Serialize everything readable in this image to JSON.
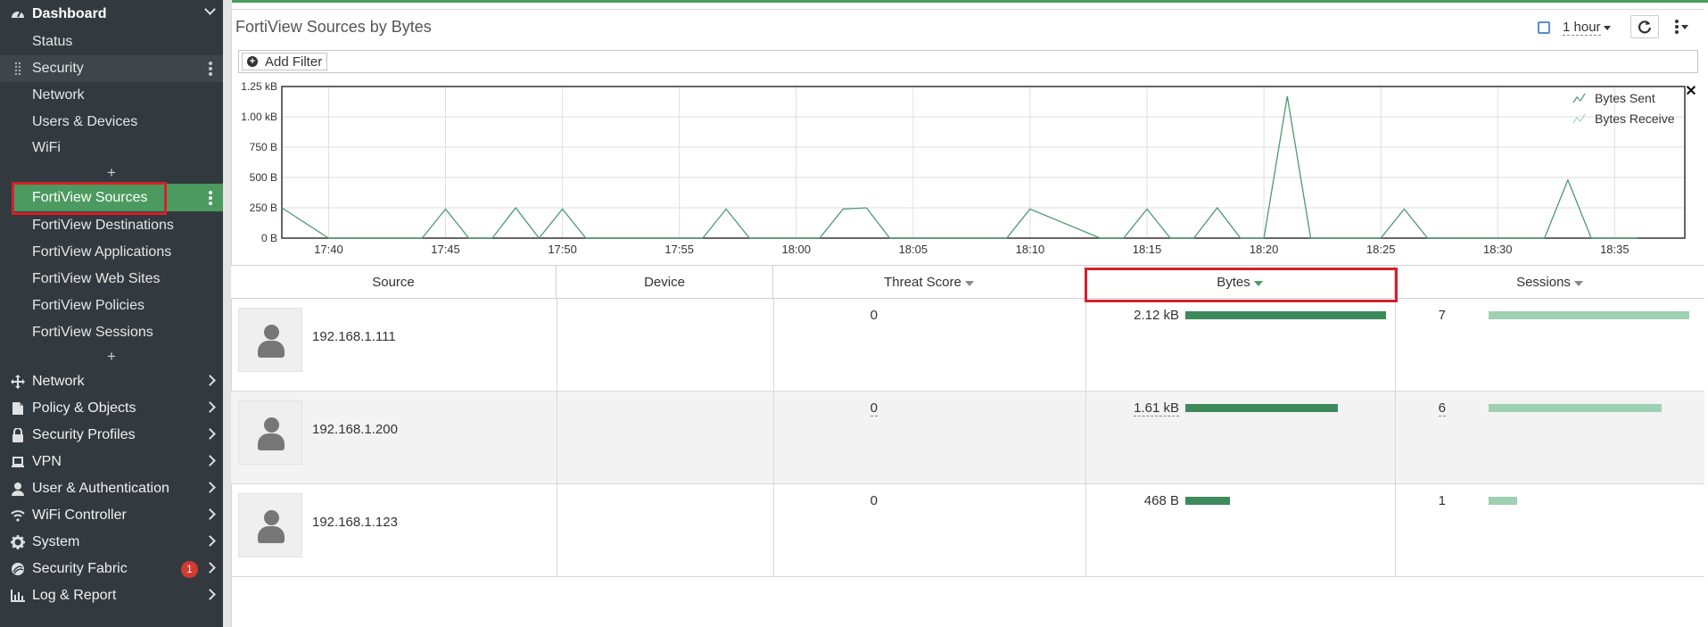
{
  "sidebar": {
    "dashboard_label": "Dashboard",
    "dashboard_items": [
      "Status",
      "Security",
      "Network",
      "Users & Devices",
      "WiFi"
    ],
    "fortiview_items": [
      "FortiView Sources",
      "FortiView Destinations",
      "FortiView Applications",
      "FortiView Web Sites",
      "FortiView Policies",
      "FortiView Sessions"
    ],
    "main_items": [
      {
        "label": "Network",
        "icon": "network-icon"
      },
      {
        "label": "Policy & Objects",
        "icon": "policy-icon"
      },
      {
        "label": "Security Profiles",
        "icon": "lock-icon"
      },
      {
        "label": "VPN",
        "icon": "laptop-icon"
      },
      {
        "label": "User & Authentication",
        "icon": "user-icon"
      },
      {
        "label": "WiFi Controller",
        "icon": "wifi-icon"
      },
      {
        "label": "System",
        "icon": "gear-icon"
      },
      {
        "label": "Security Fabric",
        "icon": "fabric-icon",
        "badge": "1"
      },
      {
        "label": "Log & Report",
        "icon": "chart-icon"
      }
    ]
  },
  "header": {
    "title": "FortiView Sources by Bytes",
    "time_range": "1 hour",
    "add_filter": "Add Filter"
  },
  "chart_data": {
    "type": "line",
    "x": [
      "17:38",
      "17:40",
      "17:42",
      "17:43",
      "17:44",
      "17:45",
      "17:46",
      "17:47",
      "17:48",
      "17:49",
      "17:50",
      "17:51",
      "17:55",
      "17:56",
      "17:57",
      "17:58",
      "18:00",
      "18:01",
      "18:02",
      "18:03",
      "18:04",
      "18:08",
      "18:09",
      "18:10",
      "18:13",
      "18:14",
      "18:15",
      "18:16",
      "18:17",
      "18:18",
      "18:19",
      "18:20",
      "18:21",
      "18:22",
      "18:25",
      "18:26",
      "18:27",
      "18:31",
      "18:32",
      "18:33",
      "18:34",
      "18:35",
      "18:36"
    ],
    "series": [
      {
        "name": "Bytes Sent",
        "values": [
          250,
          0,
          0,
          0,
          0,
          240,
          0,
          0,
          250,
          0,
          240,
          0,
          0,
          0,
          240,
          0,
          0,
          0,
          240,
          250,
          0,
          0,
          0,
          240,
          0,
          0,
          240,
          0,
          0,
          250,
          0,
          0,
          1170,
          0,
          0,
          240,
          0,
          0,
          0,
          480,
          0,
          0,
          0
        ]
      },
      {
        "name": "Bytes Receive",
        "values": []
      }
    ],
    "ylabel": "",
    "yticks": [
      "0 B",
      "250 B",
      "500 B",
      "750 B",
      "1.00 kB",
      "1.25 kB"
    ],
    "ylim": [
      0,
      1250
    ],
    "xticks": [
      "17:40",
      "17:45",
      "17:50",
      "17:55",
      "18:00",
      "18:05",
      "18:10",
      "18:15",
      "18:20",
      "18:25",
      "18:30",
      "18:35"
    ],
    "legend_position": "top-right",
    "grid": true,
    "line_color": "#4c9a6f"
  },
  "table": {
    "columns": [
      "Source",
      "Device",
      "Threat Score",
      "Bytes",
      "Sessions"
    ],
    "rows": [
      {
        "source": "192.168.1.111",
        "device": "",
        "threat": "0",
        "bytes": "2.12 kB",
        "bytes_frac": 1.0,
        "sessions": "7",
        "sessions_frac": 1.0
      },
      {
        "source": "192.168.1.200",
        "device": "",
        "threat": "0",
        "bytes": "1.61 kB",
        "bytes_frac": 0.76,
        "sessions": "6",
        "sessions_frac": 0.86
      },
      {
        "source": "192.168.1.123",
        "device": "",
        "threat": "0",
        "bytes": "468 B",
        "bytes_frac": 0.22,
        "sessions": "1",
        "sessions_frac": 0.14
      }
    ]
  },
  "colors": {
    "accent": "#4c9a5f",
    "sidebar_bg": "#333a3f",
    "highlight": "#d3212c",
    "bytes_bar": "#3d8a5c",
    "sessions_bar": "#9fd0b2"
  }
}
